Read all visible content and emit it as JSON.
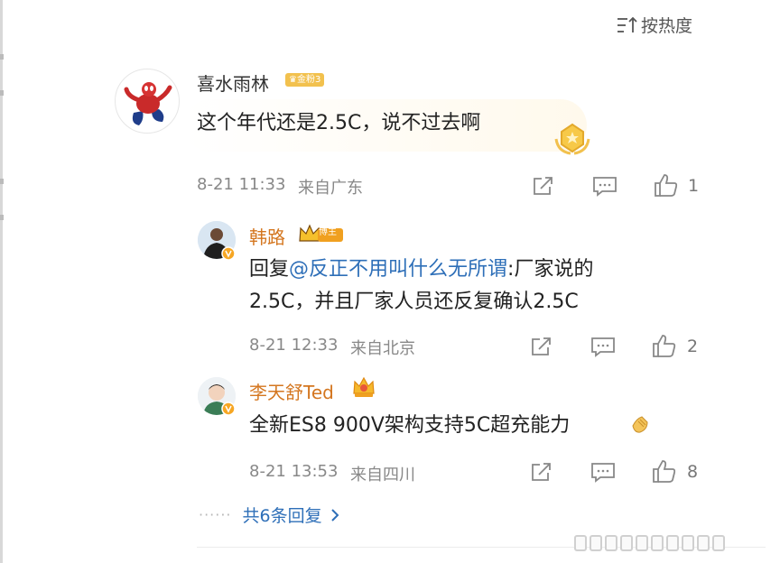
{
  "sort": {
    "label": "按热度"
  },
  "comment": {
    "username": "喜水雨林",
    "badge": "金粉3",
    "text": "这个年代还是2.5C，说不过去啊",
    "date": "8-21 11:33",
    "location": "来自广东",
    "likes": "1"
  },
  "replies": [
    {
      "username": "韩路",
      "badge": "博主",
      "prefix": "回复",
      "mention": "@反正不用叫什么无所谓",
      "text_line1": ":厂家说的",
      "text_line2": "2.5C，并且厂家人员还反复确认2.5C",
      "date": "8-21 12:33",
      "location": "来自北京",
      "likes": "2"
    },
    {
      "username": "李天舒Ted",
      "text": "全新ES8 900V架构支持5C超充能力",
      "date": "8-21 13:53",
      "location": "来自四川",
      "likes": "8"
    }
  ],
  "more_replies": {
    "dots": "······",
    "label": "共6条回复"
  },
  "colors": {
    "username": "#d4761f",
    "link": "#2e6fb8",
    "meta": "#888888",
    "gold": "#f2c14e"
  }
}
